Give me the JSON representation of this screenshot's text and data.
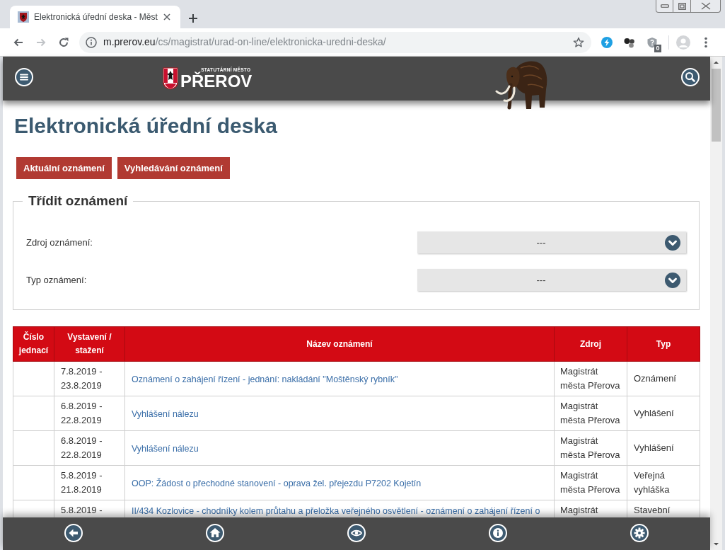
{
  "browser": {
    "tab": {
      "title": "Elektronická úřední deska - Měst",
      "selected": true
    },
    "nav": [
      {
        "kind": "back",
        "disabled": false
      },
      {
        "kind": "forward",
        "disabled": true
      },
      {
        "kind": "reload",
        "disabled": false
      }
    ],
    "address": {
      "host": "m.prerov.eu",
      "path": "/cs/magistrat/urad-on-line/elektronicka-uredni-deska/"
    },
    "extension_badge": "0"
  },
  "header": {
    "logo": {
      "subtitle": "STATUTÁRNÍ MĚSTO",
      "name": "PŘEROV"
    }
  },
  "page_title": "Elektronická úřední deska",
  "buttons": [
    "Aktuální oznámení",
    "Vyhledávání oznámení"
  ],
  "filter": {
    "legend": "Třídit oznámení",
    "fields": [
      {
        "label": "Zdroj oznámení:",
        "value": "---"
      },
      {
        "label": "Typ oznámení:",
        "value": "---"
      }
    ]
  },
  "table": {
    "columns": [
      "Číslo jednací",
      "Vystavení / stažení",
      "Název oznámení",
      "Zdroj",
      "Typ"
    ],
    "rows": [
      {
        "period": "7.8.2019 - 23.8.2019",
        "title": "Oznámení o zahájení řízení - jednání: nakládání \"Moštěnský rybník\"",
        "source": "Magistrát města Přerova",
        "type": "Oznámení"
      },
      {
        "period": "6.8.2019 - 22.8.2019",
        "title": "Vyhlášení nálezu",
        "source": "Magistrát města Přerova",
        "type": "Vyhlášení"
      },
      {
        "period": "6.8.2019 - 22.8.2019",
        "title": "Vyhlášení nálezu",
        "source": "Magistrát města Přerova",
        "type": "Vyhlášení"
      },
      {
        "period": "5.8.2019 - 21.8.2019",
        "title": "OOP: Žádost o přechodné stanovení - oprava žel. přejezdu P7202 Kojetín",
        "source": "Magistrát města Přerova",
        "type": "Veřejná vyhláška"
      },
      {
        "period": "5.8.2019 -",
        "title": "II/434 Kozlovice - chodníky kolem průtahu a přeložka veřejného osvětlení - oznámení o zahájení řízení o",
        "source": "Magistrát",
        "type": "Stavební"
      }
    ]
  }
}
